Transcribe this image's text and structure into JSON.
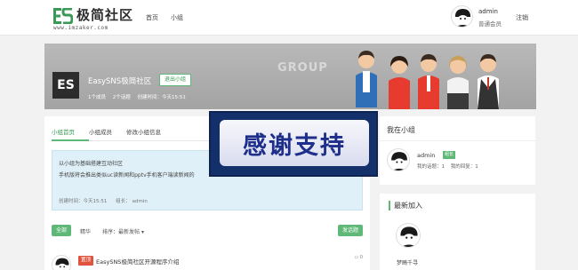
{
  "header": {
    "logo_text": "极简社区",
    "logo_url": "www.imzaker.com",
    "nav": [
      "首页",
      "小组"
    ],
    "user_name": "admin",
    "user_level": "普通会员",
    "logout_label": "注销"
  },
  "banner": {
    "group_logo": "ES",
    "group_title": "EasySNS极简社区",
    "quit_label": "退出小组",
    "members": "1个成员",
    "topics": "2个话题",
    "created": "创建时间：今天15:51",
    "group_word": "GROUP"
  },
  "main": {
    "tabs": [
      "小组首页",
      "小组成员",
      "修改小组信息"
    ],
    "intro_lines": [
      "以小组为基础搭建互动社区",
      "手机版将会推出类似uc读新闻和pptv手机客户端读新闻的"
    ],
    "intro_created": "创建时间：今天15:51",
    "intro_leader_label": "组长：",
    "intro_leader": "admin",
    "filter_all": "全部",
    "filter_featured": "精华",
    "sort_label": "排序：",
    "sort_value": "最新发帖",
    "post_button": "发话题",
    "post_tag": "置顶",
    "post_title": "EasySNS极简社区开源程序介绍",
    "post_count": "0"
  },
  "side": {
    "my_group_title": "我在小组",
    "name": "admin",
    "badge": "组长",
    "my_topics": "我的话题：1",
    "my_replies": "我的回复：1",
    "newest_title": "最新加入",
    "new_member": "梦畸千寻"
  },
  "overlay": {
    "text": "感谢支持"
  }
}
